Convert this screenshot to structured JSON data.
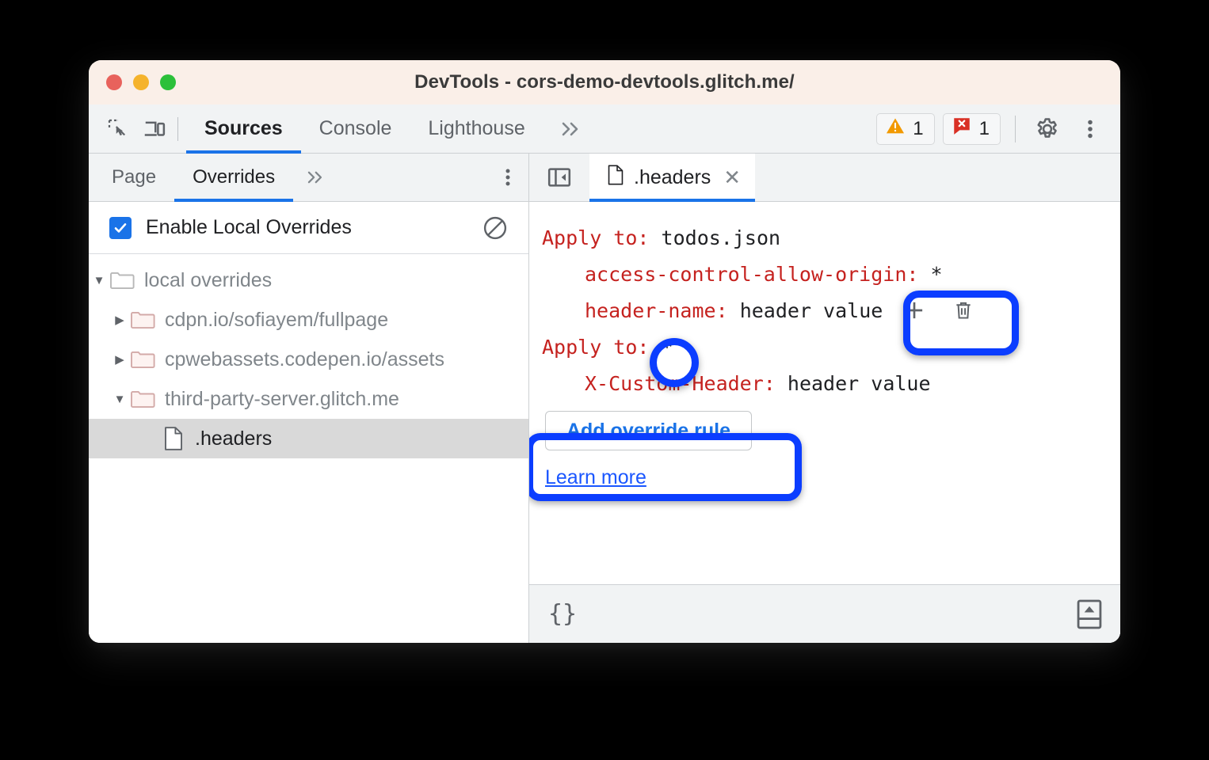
{
  "window": {
    "title": "DevTools - cors-demo-devtools.glitch.me/",
    "traffic_lights": [
      "close-red",
      "minimize-yellow",
      "maximize-green"
    ]
  },
  "toolbar": {
    "inspect_icon": "inspect-element-icon",
    "device_icon": "device-toolbar-icon",
    "tabs": [
      {
        "label": "Sources",
        "active": true
      },
      {
        "label": "Console",
        "active": false
      },
      {
        "label": "Lighthouse",
        "active": false
      }
    ],
    "more_tabs_label": "»",
    "warning_count": "1",
    "error_count": "1",
    "settings_icon": "gear-icon",
    "menu_icon": "kebab-menu-icon"
  },
  "left_panel": {
    "tabs": [
      {
        "label": "Page",
        "active": false
      },
      {
        "label": "Overrides",
        "active": true
      }
    ],
    "more_tabs_label": "»",
    "menu_icon": "kebab-menu-icon",
    "enable_overrides": {
      "label": "Enable Local Overrides",
      "checked": true,
      "clear_icon": "clear-configuration-icon"
    },
    "tree": [
      {
        "label": "local overrides",
        "icon": "folder-icon",
        "depth": 0,
        "expanded": true,
        "selected": false,
        "gray_folder": true
      },
      {
        "label": "cdpn.io/sofiayem/fullpage",
        "icon": "folder-icon",
        "depth": 1,
        "expanded": false,
        "selected": false,
        "gray_folder": false
      },
      {
        "label": "cpwebassets.codepen.io/assets",
        "icon": "folder-icon",
        "depth": 1,
        "expanded": false,
        "selected": false,
        "gray_folder": false
      },
      {
        "label": "third-party-server.glitch.me",
        "icon": "folder-icon",
        "depth": 1,
        "expanded": true,
        "selected": false,
        "gray_folder": false
      },
      {
        "label": ".headers",
        "icon": "file-icon",
        "depth": 2,
        "expanded": null,
        "selected": true,
        "gray_folder": false
      }
    ]
  },
  "right_panel": {
    "panel_toggle_icon": "show-navigator-icon",
    "tab": {
      "label": ".headers",
      "icon": "file-icon",
      "close_icon": "close-icon"
    },
    "editor": {
      "rules": [
        {
          "apply_to_label": "Apply to",
          "apply_to_value": "todos.json",
          "headers": [
            {
              "name": "access-control-allow-origin",
              "value": "*",
              "show_actions": false
            },
            {
              "name": "header-name",
              "value": "header value",
              "show_actions": true
            }
          ]
        },
        {
          "apply_to_label": "Apply to",
          "apply_to_value": "*",
          "headers": [
            {
              "name": "X-Custom-Header",
              "value": "header value",
              "show_actions": false
            }
          ]
        }
      ],
      "add_button_label": "Add override rule",
      "learn_more_label": "Learn more",
      "add_header_icon": "plus-icon",
      "remove_header_icon": "trash-icon"
    }
  },
  "statusbar": {
    "format_braces_label": "{}",
    "toggle_drawer_icon": "show-drawer-icon"
  },
  "colors": {
    "annotation_blue": "#0b3dff",
    "accent_blue": "#1a73e8",
    "link_blue": "#1a56ff",
    "header_name_red": "#c5221f",
    "titlebar_bg": "#faefe8",
    "warning_orange": "#f29900",
    "error_red": "#d93025"
  }
}
